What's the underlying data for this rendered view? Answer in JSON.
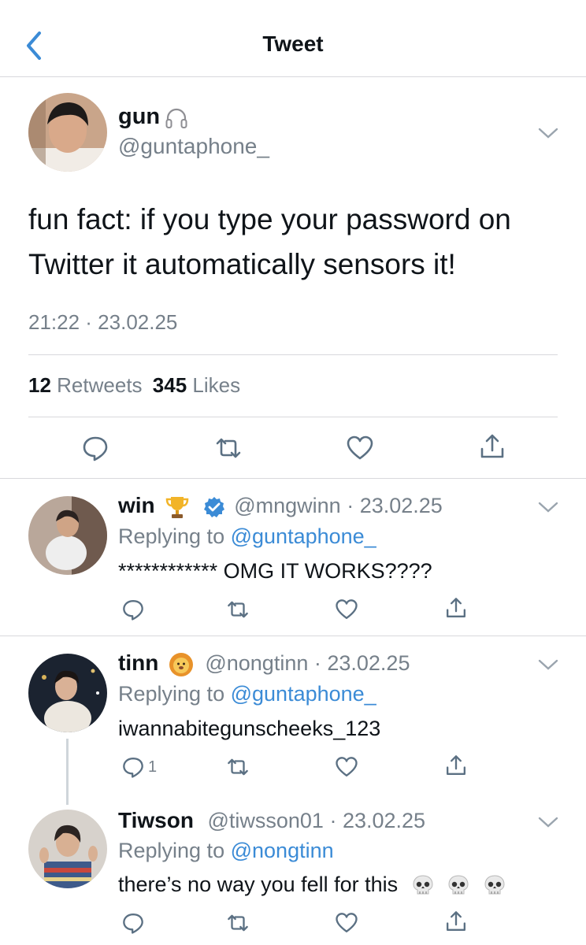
{
  "nav": {
    "title": "Tweet"
  },
  "main_tweet": {
    "author_name": "gun",
    "handle": "@guntaphone_",
    "text": "fun fact: if you type your password on Twitter it automatically sensors it!",
    "timestamp": "21:22 · 23.02.25",
    "retweet_count": "12",
    "retweet_label": "Retweets",
    "like_count": "345",
    "like_label": "Likes"
  },
  "replies": [
    {
      "name": "win",
      "handle": "@mngwinn",
      "date": "· 23.02.25",
      "replying_prefix": "Replying to",
      "replying_to": "@guntaphone_",
      "text": "************ OMG IT WORKS????",
      "reply_count": ""
    },
    {
      "name": "tinn",
      "handle": "@nongtinn",
      "date": "· 23.02.25",
      "replying_prefix": "Replying to",
      "replying_to": "@guntaphone_",
      "text": "iwannabitegunscheeks_123",
      "reply_count": "1"
    },
    {
      "name": "Tiwson",
      "handle": "@tiwsson01",
      "date": "· 23.02.25",
      "replying_prefix": "Replying to",
      "replying_to": "@nongtinn",
      "text": "there’s no way you fell for this",
      "reply_count": ""
    }
  ],
  "colors": {
    "accent": "#3b8bd6",
    "secondary_text": "#76808a",
    "icon": "#5b7083",
    "divider": "#d8d8dc"
  },
  "icons": [
    "back-chevron-icon",
    "headphones-icon",
    "trophy-icon",
    "verified-badge-icon",
    "lion-icon",
    "skull-icon",
    "reply-icon",
    "retweet-icon",
    "like-icon",
    "share-icon",
    "chevron-down-icon"
  ]
}
